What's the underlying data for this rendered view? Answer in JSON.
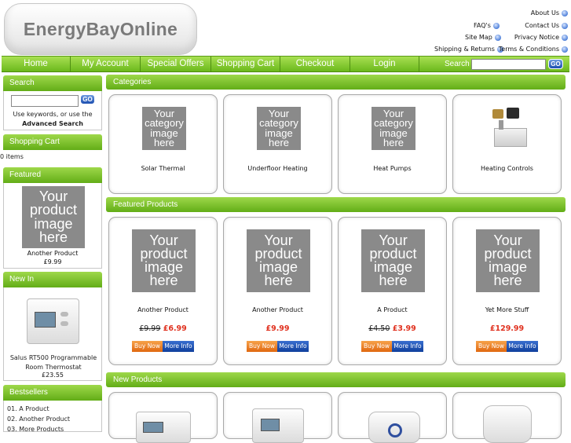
{
  "logo": {
    "text": "EnergyBayOnline"
  },
  "top_links": {
    "about": "About Us",
    "faqs": "FAQ's",
    "contact": "Contact Us",
    "sitemap": "Site Map",
    "privacy": "Privacy Notice",
    "shipping": "Shipping & Returns",
    "terms": "Terms & Conditions"
  },
  "nav": {
    "items": [
      "Home",
      "My Account",
      "Special Offers",
      "Shopping Cart",
      "Checkout",
      "Login"
    ],
    "search_label": "Search",
    "go": "GO"
  },
  "sidebar": {
    "search": {
      "title": "Search",
      "go": "GO",
      "hint": "Use keywords, or use the",
      "advanced": "Advanced Search"
    },
    "cart": {
      "title": "Shopping Cart",
      "items": "0 items"
    },
    "featured": {
      "title": "Featured",
      "placeholder": "Your product image here",
      "name": "Another Product",
      "price": "£9.99"
    },
    "new_in": {
      "title": "New In",
      "name": "Salus RT500 Programmable Room Thermostat",
      "price": "£23.55"
    },
    "bestsellers": {
      "title": "Bestsellers",
      "items": [
        "01. A Product",
        "02. Another Product",
        "03. More Products"
      ]
    }
  },
  "categories": {
    "title": "Categories",
    "placeholder": "Your category image here",
    "items": [
      "Solar Thermal",
      "Underfloor Heating",
      "Heat Pumps",
      "Heating Controls"
    ]
  },
  "featured_products": {
    "title": "Featured Products",
    "placeholder": "Your product image here",
    "buy": "Buy Now",
    "info": "More Info",
    "items": [
      {
        "name": "Another Product",
        "old_price": "£9.99",
        "price": "£6.99"
      },
      {
        "name": "Another Product",
        "old_price": "",
        "price": "£9.99"
      },
      {
        "name": "A Product",
        "old_price": "£4.50",
        "price": "£3.99"
      },
      {
        "name": "Yet More Stuff",
        "old_price": "",
        "price": "£129.99"
      }
    ]
  },
  "new_products": {
    "title": "New Products"
  }
}
